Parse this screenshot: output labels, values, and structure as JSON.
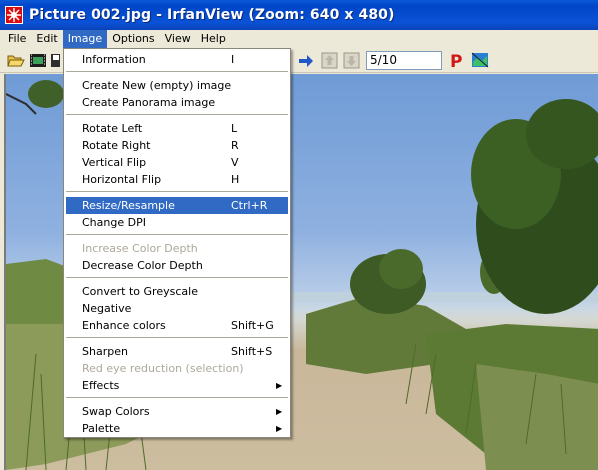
{
  "window": {
    "title": "Picture 002.jpg - IrfanView (Zoom: 640 x 480)"
  },
  "menubar": {
    "items": [
      "File",
      "Edit",
      "Image",
      "Options",
      "View",
      "Help"
    ]
  },
  "toolbar": {
    "page_indicator": "5/10"
  },
  "image_menu": {
    "items": [
      {
        "label": "Information",
        "shortcut": "I"
      },
      {
        "label": "Create New (empty) image",
        "shortcut": ""
      },
      {
        "label": "Create Panorama image",
        "shortcut": ""
      },
      {
        "label": "Rotate Left",
        "shortcut": "L"
      },
      {
        "label": "Rotate Right",
        "shortcut": "R"
      },
      {
        "label": "Vertical Flip",
        "shortcut": "V"
      },
      {
        "label": "Horizontal Flip",
        "shortcut": "H"
      },
      {
        "label": "Resize/Resample",
        "shortcut": "Ctrl+R"
      },
      {
        "label": "Change DPI",
        "shortcut": ""
      },
      {
        "label": "Increase Color Depth",
        "shortcut": ""
      },
      {
        "label": "Decrease Color Depth",
        "shortcut": ""
      },
      {
        "label": "Convert to Greyscale",
        "shortcut": ""
      },
      {
        "label": "Negative",
        "shortcut": ""
      },
      {
        "label": "Enhance colors",
        "shortcut": "Shift+G"
      },
      {
        "label": "Sharpen",
        "shortcut": "Shift+S"
      },
      {
        "label": "Red eye reduction (selection)",
        "shortcut": ""
      },
      {
        "label": "Effects",
        "shortcut": ""
      },
      {
        "label": "Swap Colors",
        "shortcut": ""
      },
      {
        "label": "Palette",
        "shortcut": ""
      }
    ],
    "highlighted": "Resize/Resample",
    "disabled": [
      "Increase Color Depth",
      "Red eye reduction (selection)"
    ],
    "submenus": [
      "Effects",
      "Swap Colors",
      "Palette"
    ]
  },
  "colors": {
    "titlebar": "#0a52d6",
    "menu_highlight": "#316ac5",
    "disabled_text": "#aca899",
    "app_icon": "#d90d0d"
  }
}
